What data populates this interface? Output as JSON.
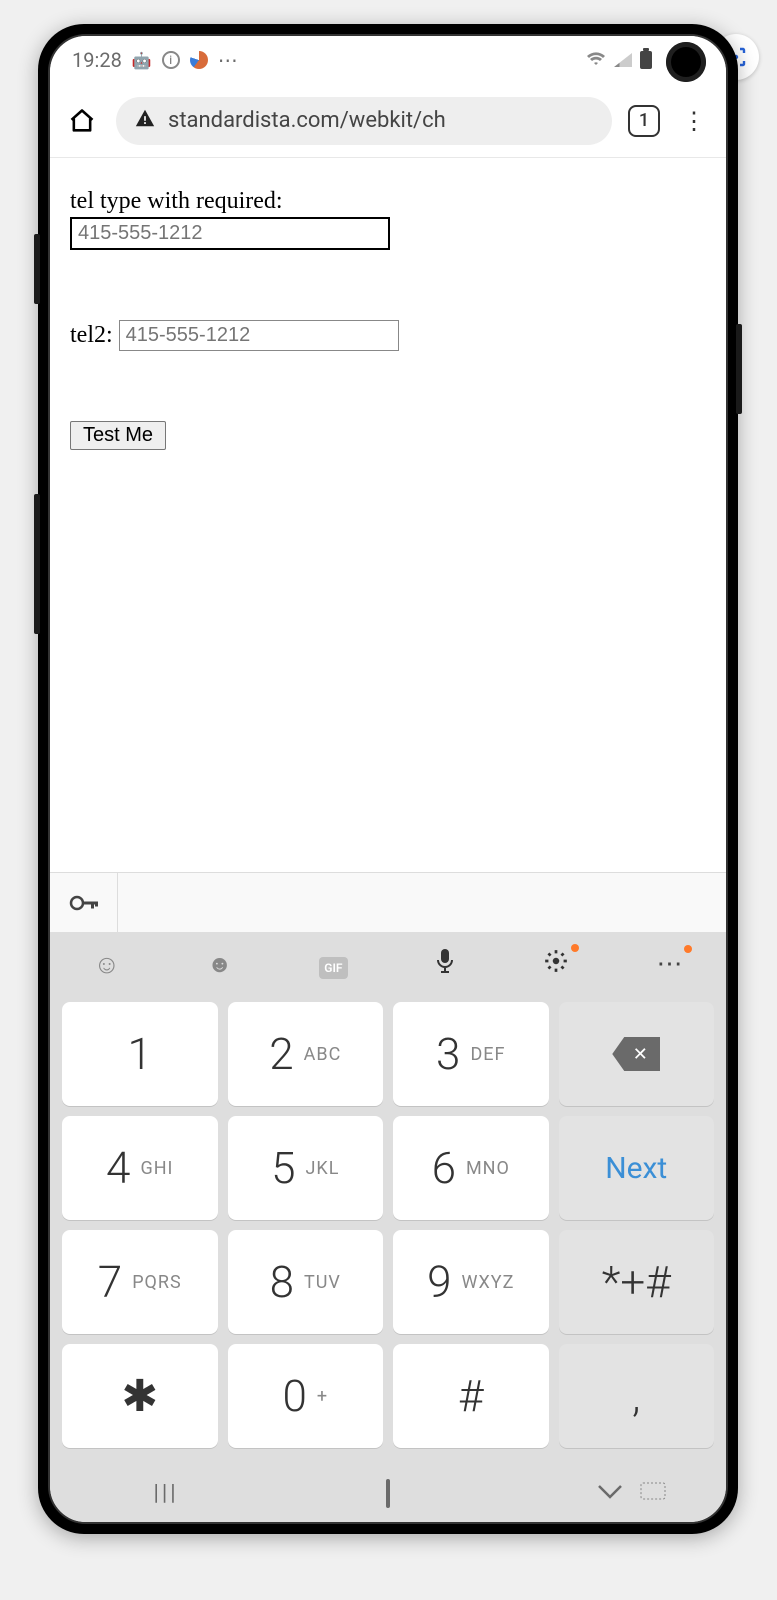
{
  "status": {
    "time": "19:28",
    "icons": [
      "android-icon",
      "info-icon",
      "swirl-icon",
      "more-icon"
    ],
    "right_icons": [
      "wifi-icon",
      "signal-icon",
      "battery-icon"
    ]
  },
  "browser": {
    "url": "standardista.com/webkit/ch",
    "tab_count": "1"
  },
  "page": {
    "label1": "tel type with required:",
    "input1_placeholder": "415-555-1212",
    "label2": "tel2:",
    "input2_placeholder": "415-555-1212",
    "button": "Test Me"
  },
  "keyboard": {
    "toolbar": [
      "emoji-icon",
      "sticker-icon",
      "gif-icon",
      "mic-icon",
      "settings-icon",
      "more-icon"
    ],
    "keys": [
      {
        "num": "1",
        "sub": ""
      },
      {
        "num": "2",
        "sub": "ABC"
      },
      {
        "num": "3",
        "sub": "DEF"
      },
      {
        "type": "backspace"
      },
      {
        "num": "4",
        "sub": "GHI"
      },
      {
        "num": "5",
        "sub": "JKL"
      },
      {
        "num": "6",
        "sub": "MNO"
      },
      {
        "type": "next",
        "label": "Next"
      },
      {
        "num": "7",
        "sub": "PQRS"
      },
      {
        "num": "8",
        "sub": "TUV"
      },
      {
        "num": "9",
        "sub": "WXYZ"
      },
      {
        "num": "*+#",
        "sub": "",
        "gray": true
      },
      {
        "num": "✱",
        "sub": "",
        "gray": false,
        "star": true
      },
      {
        "num": "0",
        "sub": "+"
      },
      {
        "num": "#",
        "sub": "",
        "gray": false
      },
      {
        "num": ",",
        "sub": "",
        "gray": true
      }
    ]
  },
  "scan_icon": "⌞⌝"
}
